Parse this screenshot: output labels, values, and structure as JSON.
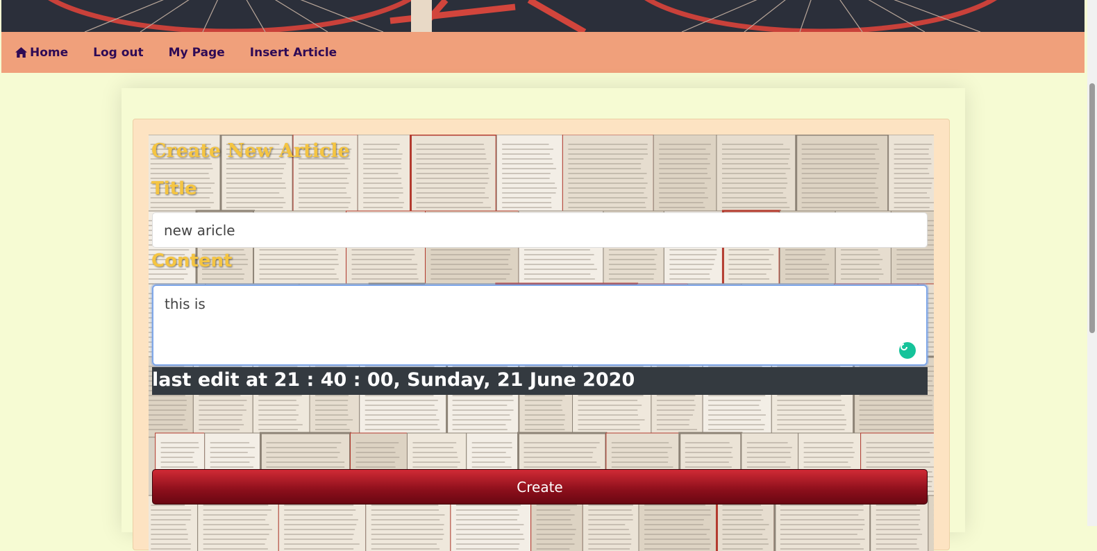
{
  "nav": {
    "home": "Home",
    "logout": "Log out",
    "mypage": "My Page",
    "insert": "Insert Article"
  },
  "form": {
    "heading": "Create New Article",
    "title_label": "Title",
    "title_value": "new aricle",
    "content_label": "Content",
    "content_value": "this is",
    "last_edit": "last edit at 21 : 40 : 00, Sunday, 21 June 2020",
    "create_label": "Create"
  },
  "colors": {
    "nav_bg": "#f0a07b",
    "nav_text": "#2e0a55",
    "page_bg": "#f6fbd3",
    "label_color": "#f5c542",
    "button": "#a0101d"
  }
}
